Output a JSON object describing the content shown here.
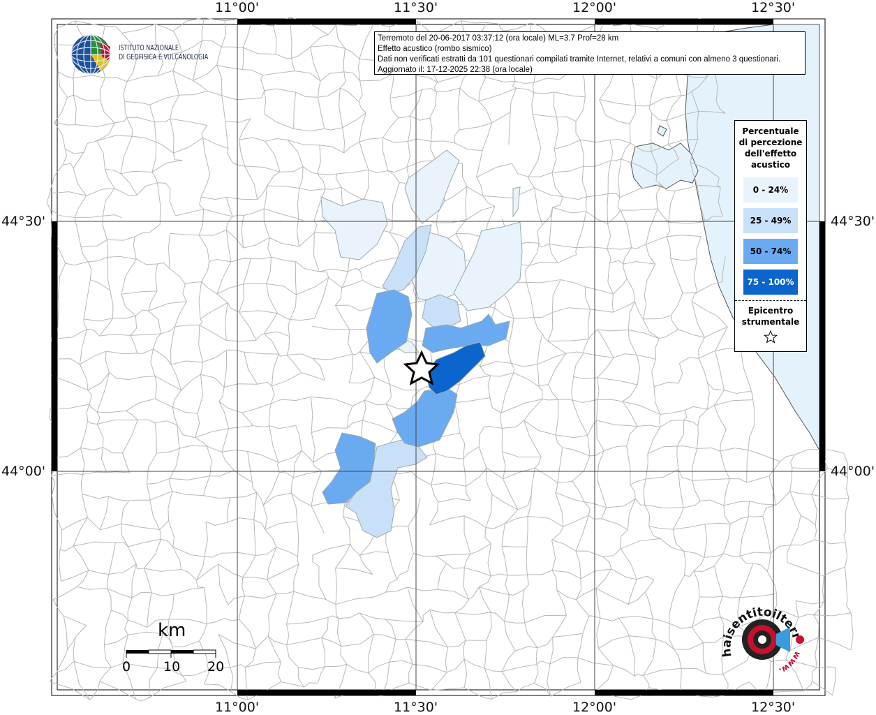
{
  "coords": {
    "top": [
      "11°00'",
      "11°30'",
      "12°00'",
      "12°30'"
    ],
    "bottom": [
      "11°00'",
      "11°30'",
      "12°00'",
      "12°30'"
    ],
    "left": [
      "44°30'",
      "44°00'"
    ],
    "right": [
      "44°30'",
      "44°00'"
    ]
  },
  "logo": {
    "line1": "ISTITUTO NAZIONALE",
    "line2": "DI GEOFISICA E VULCANOLOGIA"
  },
  "info": {
    "line1": "Terremoto del 20-06-2017 03:37:12 (ora locale) ML=3.7 Prof=28 km",
    "line2": "Effetto acustico (rombo sismico)",
    "line3": "Dati non verificati estratti da 101 questionari compilati tramite Internet, relativi a comuni con almeno 3 questionari.",
    "line4": "Aggiornato il: 17-12-2025 22:38 (ora locale)"
  },
  "legend": {
    "title": "Percentuale di percezione dell'effetto acustico",
    "title_lines": [
      "Percentuale",
      "di percezione",
      "dell'effetto",
      "acustico"
    ],
    "classes": [
      {
        "label": "0 - 24%",
        "color": "#e8f3fc",
        "text_color": "#000000"
      },
      {
        "label": "25 - 49%",
        "color": "#c9e1f8",
        "text_color": "#000000"
      },
      {
        "label": "50 - 74%",
        "color": "#6aaaf1",
        "text_color": "#000000"
      },
      {
        "label": "75 - 100%",
        "color": "#0a66cc",
        "text_color": "#ffffff"
      }
    ],
    "epicenter_lines": [
      "Epicentro",
      "strumentale"
    ],
    "epicenter_icon": "star-icon"
  },
  "scale": {
    "unit": "km",
    "ticks": [
      "0",
      "10",
      "20"
    ]
  },
  "brand": {
    "text_main": "haisentitoilterremoto.it",
    "text_sub": "www.",
    "icon": "megaphone-target-icon"
  },
  "colors": {
    "sea": "#e4f2fc",
    "border_lines": "#b5b5b5",
    "grid": "#555555",
    "frame": "#000000"
  }
}
